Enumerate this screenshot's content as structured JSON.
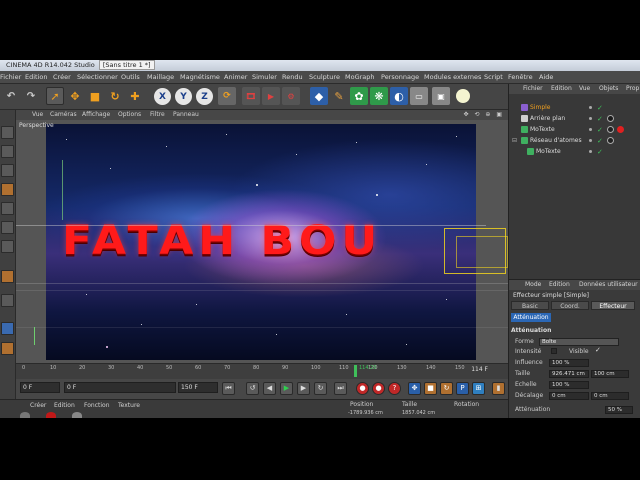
{
  "app": {
    "title": "CINEMA 4D R14.042 Studio",
    "doc_tab": "[Sans titre 1 *]"
  },
  "menubar": [
    "Fichier",
    "Edition",
    "Créer",
    "Sélectionner",
    "Outils",
    "Maillage",
    "Magnétisme",
    "Animer",
    "Simuler",
    "Rendu",
    "Sculpture",
    "MoGraph",
    "Personnage",
    "Modules externes",
    "Script",
    "Fenêtre",
    "Aide"
  ],
  "toolbar": {
    "axis_x": "X",
    "axis_y": "Y",
    "axis_z": "Z"
  },
  "viewport": {
    "menu": [
      "Vue",
      "Caméras",
      "Affichage",
      "Options",
      "Filtre",
      "Panneau"
    ],
    "label": "Perspective",
    "text_3d": "FATAH BOU"
  },
  "timeline": {
    "ticks": [
      "0",
      "10",
      "20",
      "30",
      "40",
      "50",
      "60",
      "70",
      "80",
      "90",
      "100",
      "110",
      "120",
      "130",
      "140",
      "150"
    ],
    "current_marker": "114.20",
    "frame_readout": "114 F"
  },
  "transport": {
    "start_field": "0 F",
    "mid_field": "0 F",
    "end_field": "150 F"
  },
  "bottom_bar": {
    "menu": [
      "Créer",
      "Edition",
      "Fonction",
      "Texture"
    ]
  },
  "coords": {
    "position": "Position",
    "size": "Taille",
    "rotation": "Rotation",
    "pos_val": "-1789.936 cm",
    "size_val": "1857.042 cm"
  },
  "object_manager": {
    "menu": [
      "Fichier",
      "Edition",
      "Vue",
      "Objets",
      "Prop"
    ],
    "items": [
      {
        "label": "Simple",
        "selected": true
      },
      {
        "label": "Arrière plan",
        "selected": false
      },
      {
        "label": "MoTexte",
        "selected": false
      },
      {
        "label": "Réseau d'atomes",
        "selected": false
      },
      {
        "label": "MoTexte",
        "selected": false
      }
    ]
  },
  "attributes": {
    "menu": [
      "Mode",
      "Edition",
      "Données utilisateur"
    ],
    "title": "Effecteur simple [Simple]",
    "tabs": [
      "Basic",
      "Coord.",
      "Effecteur"
    ],
    "subtab": "Atténuation",
    "section": "Atténuation",
    "forme_label": "Forme",
    "forme_value": "Boîte",
    "intensity_label": "Intensité",
    "visible_label": "Visible",
    "influence_label": "Influence",
    "influence_value": "100 %",
    "taille_label": "Taille",
    "taille_x": "926.471 cm",
    "taille_y": "100 cm",
    "echelle_label": "Echelle",
    "echelle_value": "100 %",
    "decalage_label": "Décalage",
    "decalage_x": "0 cm",
    "decalage_y": "0 cm",
    "attenuation_label": "Atténuation",
    "attenuation_value": "50 %"
  }
}
